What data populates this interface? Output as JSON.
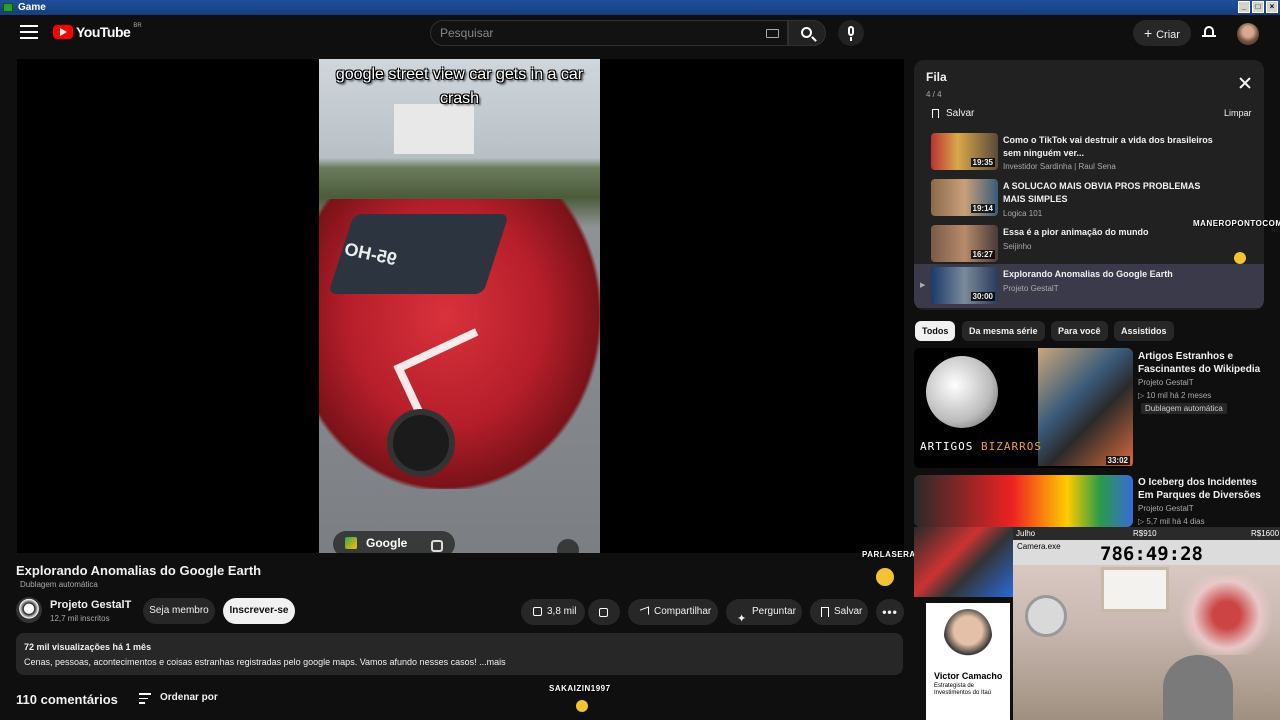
{
  "window": {
    "title": "Game",
    "controls": [
      "_",
      "□",
      "×"
    ]
  },
  "masthead": {
    "logo_text": "YouTube",
    "country_code": "BR",
    "search_placeholder": "Pesquisar",
    "create_label": "Criar",
    "icons": [
      "menu-icon",
      "keyboard-icon",
      "search-icon",
      "mic-icon",
      "plus-icon",
      "bell-icon",
      "avatar"
    ]
  },
  "player": {
    "caption": "google street view car gets in a car crash",
    "maps_label": "Google",
    "plate_text": "95-HO"
  },
  "video": {
    "title": "Explorando Anomalias do Google Earth",
    "dub_label": "Dublagem automática",
    "channel_name": "Projeto GestalT",
    "channel_subs": "12,7 mil inscritos",
    "join_label": "Seja membro",
    "subscribe_label": "Inscrever-se",
    "likes": "3,8 mil",
    "share_label": "Compartilhar",
    "ask_label": "Perguntar",
    "save_label": "Salvar",
    "more_label": "•••",
    "stats": "72 mil visualizações  há 1 mês",
    "description": "Cenas, pessoas, acontecimentos e coisas estranhas registradas pelo google maps. Vamos afundo nesses casos! ...mais",
    "comments_count": "110 comentários",
    "sort_label": "Ordenar por"
  },
  "queue": {
    "title": "Fila",
    "count": "4 / 4",
    "save_label": "Salvar",
    "clear_label": "Limpar",
    "items": [
      {
        "title": "Como o TikTok vai destruir a vida dos brasileiros sem ninguém ver...",
        "channel": "Investidor Sardinha | Raul Sena",
        "duration": "19:35",
        "active": false
      },
      {
        "title": "A SOLUCAO MAIS OBVIA PROS PROBLEMAS MAIS SIMPLES",
        "channel": "Logica 101",
        "duration": "19:14",
        "active": false
      },
      {
        "title": "Essa é a pior animação do mundo",
        "channel": "Seijinho",
        "duration": "16:27",
        "active": false
      },
      {
        "title": "Explorando Anomalias do Google Earth",
        "channel": "Projeto GestalT",
        "duration": "30:00",
        "active": true
      }
    ]
  },
  "chips": [
    "Todos",
    "Da mesma série",
    "Para você",
    "Assistidos"
  ],
  "recommendations": [
    {
      "title": "Artigos Estranhos e Fascinantes do Wikipedia",
      "channel": "Projeto GestalT",
      "meta": "▷ 10 mil  há 2 meses",
      "badge": "Dublagem automática",
      "duration": "33:02",
      "thumb_text_1": "ARTIGOS",
      "thumb_text_2": "BIZARROS"
    },
    {
      "title": "O Iceberg dos Incidentes Em Parques de Diversões",
      "channel": "Projeto GestalT",
      "meta": "▷ 5,7 mil  há 4 dias"
    }
  ],
  "overlays": {
    "maneiro": "MANEROPONTOCOM",
    "parlasera": "PARLASERA",
    "sakaizin": "SAKAIZIN1997"
  },
  "split": {
    "label": "Julho",
    "money_1": "R$910",
    "money_2": "R$1600",
    "cam_label": "Camera.exe",
    "timer": "786:49:28"
  },
  "ad": {
    "name": "Victor Camacho",
    "subtitle": "Estrategista de Investimentos do Itaú"
  }
}
